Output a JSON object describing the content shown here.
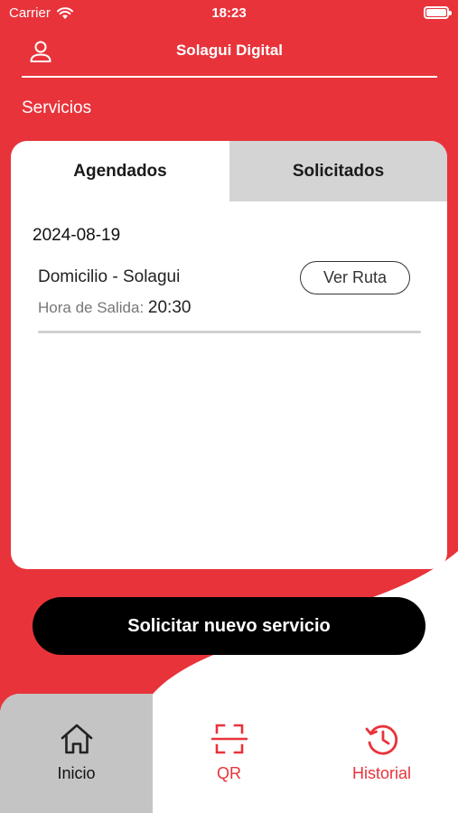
{
  "status_bar": {
    "carrier": "Carrier",
    "time": "18:23"
  },
  "header": {
    "title": "Solagui Digital"
  },
  "section": {
    "title": "Servicios"
  },
  "tabs": [
    {
      "label": "Agendados",
      "active": true
    },
    {
      "label": "Solicitados",
      "active": false
    }
  ],
  "schedule": {
    "date": "2024-08-19",
    "items": [
      {
        "route_name": "Domicilio - Solagui",
        "departure_label": "Hora de Salida:",
        "departure_time": "20:30",
        "button_label": "Ver Ruta"
      }
    ]
  },
  "actions": {
    "request_label": "Solicitar nuevo servicio"
  },
  "nav": [
    {
      "label": "Inicio",
      "icon": "home-icon",
      "active": true
    },
    {
      "label": "QR",
      "icon": "qr-scan-icon",
      "active": false
    },
    {
      "label": "Historial",
      "icon": "history-icon",
      "active": false
    }
  ],
  "colors": {
    "accent": "#e8333b",
    "inactive_tab": "#d4d4d4",
    "active_nav": "#c4c4c4"
  }
}
